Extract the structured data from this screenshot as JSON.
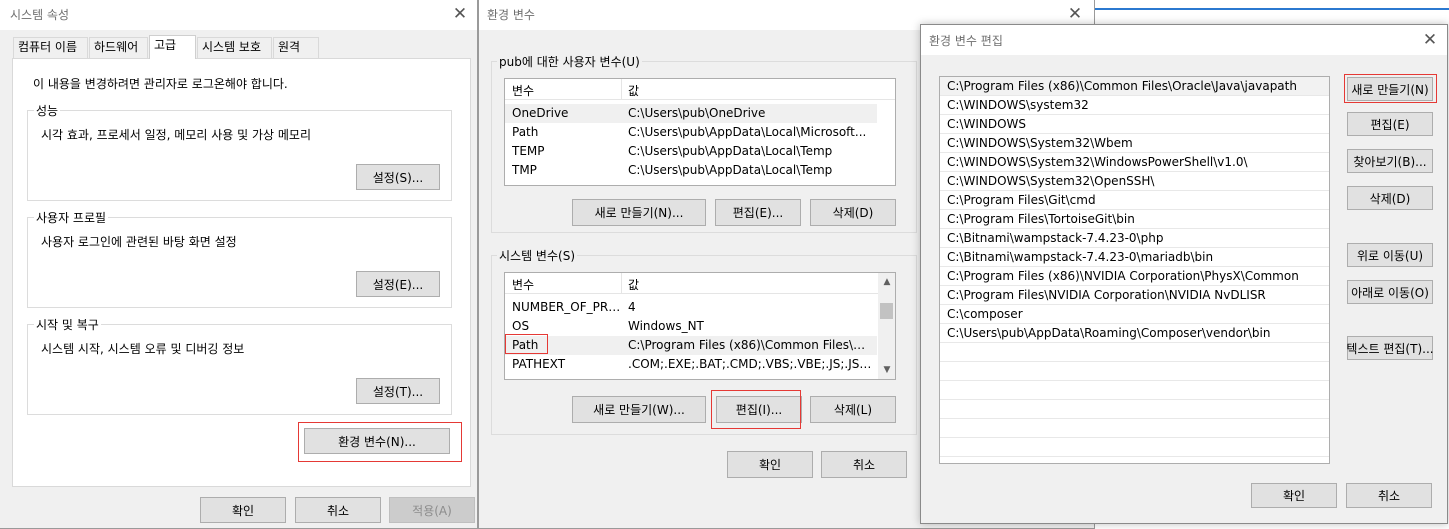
{
  "sys_props": {
    "title": "시스템 속성",
    "close": "✕",
    "tabs": [
      "컴퓨터 이름",
      "하드웨어",
      "고급",
      "시스템 보호",
      "원격"
    ],
    "admin_note": "이 내용을 변경하려면 관리자로 로그온해야 합니다.",
    "performance": {
      "label": "성능",
      "desc": "시각 효과, 프로세서 일정, 메모리 사용 및 가상 메모리",
      "button": "설정(S)..."
    },
    "user_profile": {
      "label": "사용자 프로필",
      "desc": "사용자 로그인에 관련된 바탕 화면 설정",
      "button": "설정(E)..."
    },
    "startup": {
      "label": "시작 및 복구",
      "desc": "시스템 시작, 시스템 오류 및 디버깅 정보",
      "button": "설정(T)..."
    },
    "env_button": "환경 변수(N)...",
    "ok": "확인",
    "cancel": "취소",
    "apply": "적용(A)"
  },
  "env_vars": {
    "title": "환경 변수",
    "close": "✕",
    "user_group_label": "pub에 대한 사용자 변수(U)",
    "col_var": "변수",
    "col_val": "값",
    "user_vars": [
      {
        "name": "OneDrive",
        "value": "C:\\Users\\pub\\OneDrive"
      },
      {
        "name": "Path",
        "value": "C:\\Users\\pub\\AppData\\Local\\Microsoft..."
      },
      {
        "name": "TEMP",
        "value": "C:\\Users\\pub\\AppData\\Local\\Temp"
      },
      {
        "name": "TMP",
        "value": "C:\\Users\\pub\\AppData\\Local\\Temp"
      }
    ],
    "user_new": "새로 만들기(N)...",
    "user_edit": "편집(E)...",
    "user_delete": "삭제(D)",
    "sys_group_label": "시스템 변수(S)",
    "sys_vars": [
      {
        "name": "NUMBER_OF_PRO...",
        "value": "4"
      },
      {
        "name": "OS",
        "value": "Windows_NT"
      },
      {
        "name": "Path",
        "value": "C:\\Program Files (x86)\\Common Files\\Or..."
      },
      {
        "name": "PATHEXT",
        "value": ".COM;.EXE;.BAT;.CMD;.VBS;.VBE;.JS;.JSE;.W..."
      }
    ],
    "sys_new": "새로 만들기(W)...",
    "sys_edit": "편집(I)...",
    "sys_delete": "삭제(L)",
    "ok": "확인",
    "cancel": "취소"
  },
  "edit_env": {
    "title": "환경 변수 편집",
    "close": "✕",
    "paths": [
      "C:\\Program Files (x86)\\Common Files\\Oracle\\Java\\javapath",
      "C:\\WINDOWS\\system32",
      "C:\\WINDOWS",
      "C:\\WINDOWS\\System32\\Wbem",
      "C:\\WINDOWS\\System32\\WindowsPowerShell\\v1.0\\",
      "C:\\WINDOWS\\System32\\OpenSSH\\",
      "C:\\Program Files\\Git\\cmd",
      "C:\\Program Files\\TortoiseGit\\bin",
      "C:\\Bitnami\\wampstack-7.4.23-0\\php",
      "C:\\Bitnami\\wampstack-7.4.23-0\\mariadb\\bin",
      "C:\\Program Files (x86)\\NVIDIA Corporation\\PhysX\\Common",
      "C:\\Program Files\\NVIDIA Corporation\\NVIDIA NvDLISR",
      "C:\\composer",
      "C:\\Users\\pub\\AppData\\Roaming\\Composer\\vendor\\bin"
    ],
    "new": "새로 만들기(N)",
    "edit": "편집(E)",
    "browse": "찾아보기(B)...",
    "delete": "삭제(D)",
    "move_up": "위로 이동(U)",
    "move_down": "아래로 이동(O)",
    "edit_text": "텍스트 편집(T)...",
    "ok": "확인",
    "cancel": "취소"
  },
  "colors": {
    "highlight": "#e53935",
    "accent": "#0078d7"
  }
}
